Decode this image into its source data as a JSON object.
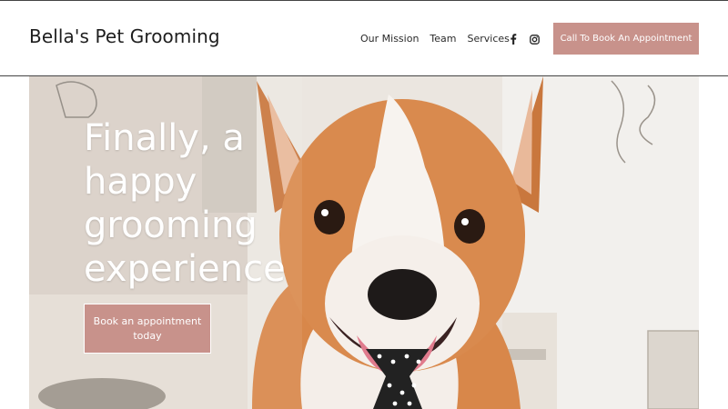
{
  "brand": {
    "name": "Bella's Pet Grooming"
  },
  "nav": {
    "items": [
      {
        "label": "Our Mission"
      },
      {
        "label": "Team"
      },
      {
        "label": "Services"
      }
    ],
    "social": [
      {
        "icon": "facebook-icon"
      },
      {
        "icon": "instagram-icon"
      }
    ],
    "cta_label": "Call To Book An Appointment"
  },
  "hero": {
    "title": "Finally, a happy grooming experience",
    "button_label": "Book an appointment today",
    "image": "corgi-wearing-polka-dot-tie"
  },
  "colors": {
    "accent": "#c8928b",
    "text": "#1e1e1e",
    "hero_text": "#ffffff"
  }
}
